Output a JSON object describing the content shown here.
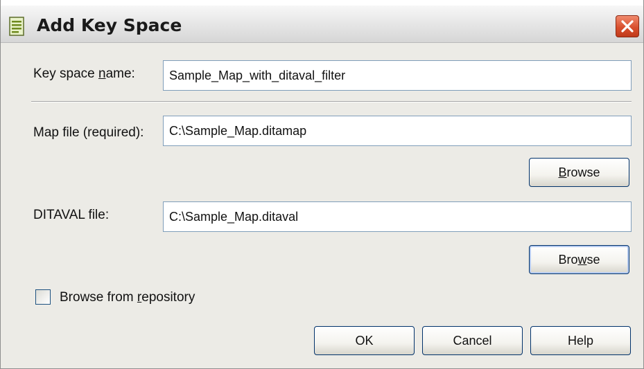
{
  "window": {
    "title": "Add Key Space"
  },
  "form": {
    "key_space_label": "Key space name:",
    "key_space_value": "Sample_Map_with_ditaval_filter",
    "map_file_label": "Map file (required):",
    "map_file_value": "C:\\Sample_Map.ditamap",
    "ditaval_label": "DITAVAL file:",
    "ditaval_value": "C:\\Sample_Map.ditaval",
    "browse_label_1": "Browse",
    "browse_label_2": "Browse",
    "repository_checkbox_label": "Browse from repository",
    "repository_checked": false
  },
  "footer": {
    "ok_label": "OK",
    "cancel_label": "Cancel",
    "help_label": "Help"
  },
  "icons": {
    "title_icon": "document-icon",
    "close_icon": "close-icon"
  },
  "colors": {
    "close_button": "#d9502e",
    "dialog_background": "#ecebe6",
    "field_border": "#7f9db9",
    "button_border": "#00316a"
  }
}
